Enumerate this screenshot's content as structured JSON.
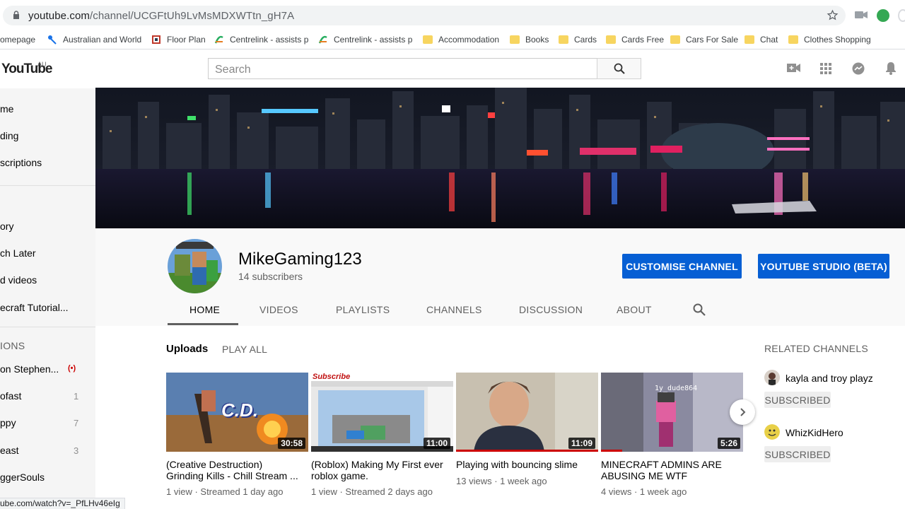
{
  "browser": {
    "url_host": "youtube.com",
    "url_path": "/channel/UCGFtUh9LvMsMDXWTtn_gH7A",
    "status_link": "ube.com/watch?v=_PfLHv46eIg"
  },
  "bookmarks": [
    {
      "label": "omepage",
      "icon": "page-icon"
    },
    {
      "label": "Australian and World",
      "icon": "news-icon"
    },
    {
      "label": "Floor Plan",
      "icon": "floorplan-icon"
    },
    {
      "label": "Centrelink - assists p",
      "icon": "centrelink-icon"
    },
    {
      "label": "Centrelink - assists p",
      "icon": "centrelink-icon"
    },
    {
      "label": "Accommodation",
      "icon": "folder-icon"
    },
    {
      "label": "Books",
      "icon": "folder-icon"
    },
    {
      "label": "Cards",
      "icon": "folder-icon"
    },
    {
      "label": "Cards Free",
      "icon": "folder-icon"
    },
    {
      "label": "Cars For Sale",
      "icon": "folder-icon"
    },
    {
      "label": "Chat",
      "icon": "folder-icon"
    },
    {
      "label": "Clothes Shopping",
      "icon": "folder-icon"
    }
  ],
  "header": {
    "logo": "YouTube",
    "country": "AU",
    "search_placeholder": "Search"
  },
  "sidebar": {
    "items": [
      {
        "label": "me"
      },
      {
        "label": "ding"
      },
      {
        "label": "scriptions"
      },
      {
        "label": "ory"
      },
      {
        "label": "ch Later"
      },
      {
        "label": "d videos"
      },
      {
        "label": "ecraft Tutorial..."
      }
    ],
    "section_title": "IONS",
    "subscriptions": [
      {
        "label": "on Stephen...",
        "live": true,
        "count": ""
      },
      {
        "label": "ofast",
        "count": "1"
      },
      {
        "label": "ppy",
        "count": "7"
      },
      {
        "label": "east",
        "count": "3"
      },
      {
        "label": "ggerSouls",
        "count": ""
      }
    ]
  },
  "channel": {
    "name": "MikeGaming123",
    "subscribers": "14 subscribers",
    "customise_label": "CUSTOMISE CHANNEL",
    "studio_label": "YOUTUBE STUDIO (BETA)",
    "tabs": [
      "HOME",
      "VIDEOS",
      "PLAYLISTS",
      "CHANNELS",
      "DISCUSSION",
      "ABOUT"
    ],
    "active_tab": "HOME"
  },
  "uploads": {
    "title": "Uploads",
    "play_all": "PLAY ALL",
    "videos": [
      {
        "title": "(Creative Destruction) Grinding Kills - Chill Stream ...",
        "duration": "30:58",
        "meta": "1 view · Streamed 1 day ago",
        "thumb_text": "C.D."
      },
      {
        "title": "(Roblox) Making My First ever roblox game.",
        "duration": "11:00",
        "meta": "1 view · Streamed 2 days ago",
        "thumb_text": "Subscribe"
      },
      {
        "title": "Playing with bouncing slime",
        "duration": "11:09",
        "meta": "13 views · 1 week ago"
      },
      {
        "title": "MINECRAFT ADMINS ARE ABUSING ME WTF",
        "duration": "5:26",
        "meta": "4 views · 1 week ago",
        "thumb_text": "1y_dude864"
      }
    ]
  },
  "related": {
    "title": "RELATED CHANNELS",
    "channels": [
      {
        "name": "kayla and troy playz",
        "button": "SUBSCRIBED"
      },
      {
        "name": "WhizKidHero",
        "button": "SUBSCRIBED"
      }
    ]
  },
  "colors": {
    "accent_blue": "#065fd4",
    "sidebar_bg": "#f5f5f5",
    "header_bg": "#f9f9f9",
    "live_red": "#cc0000"
  }
}
